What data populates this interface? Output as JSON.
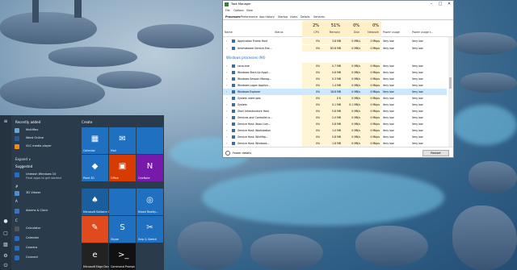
{
  "desktop": {},
  "start": {
    "recently_added": "Recently added",
    "recent": [
      {
        "label": "Multiflex",
        "color": "#6aa3d8",
        "icon": "app-icon"
      },
      {
        "label": "Word Online",
        "color": "#2b579a",
        "icon": "word-icon"
      },
      {
        "label": "VLC media player",
        "color": "#f08a1c",
        "icon": "vlc-icon"
      }
    ],
    "expand": "Expand ∨",
    "suggested": "Suggested",
    "suggest_item": {
      "line1": "Unleash Windows 10",
      "line2": "Final apps to get started"
    },
    "hash": "#",
    "letter_a": "A",
    "letter_c": "C",
    "list_a": [
      {
        "label": "3D Viewer",
        "color": "#4e8cd8"
      },
      {
        "label": "Alarms & Clock",
        "color": "#3a74c4"
      }
    ],
    "list_c": [
      {
        "label": "Calculator",
        "color": "#555"
      },
      {
        "label": "Calendar",
        "color": "#2a6ac0"
      },
      {
        "label": "Camera",
        "color": "#2a6ac0"
      },
      {
        "label": "Connect",
        "color": "#2a6ac0"
      }
    ],
    "create": "Create",
    "tiles": [
      {
        "label": "Calendar",
        "icon": "calendar-icon",
        "glyph": "▦",
        "color": "#1f70c1"
      },
      {
        "label": "Mail",
        "icon": "mail-icon",
        "glyph": "✉",
        "color": "#1f70c1"
      },
      {
        "label": "",
        "icon": "blank-tile",
        "glyph": "",
        "color": "#1f70c1"
      },
      {
        "label": "Paint 3D",
        "icon": "paint3d-icon",
        "glyph": "◆",
        "color": "#1f70c1"
      },
      {
        "label": "Office",
        "icon": "office-icon",
        "glyph": "▣",
        "color": "#d83b01"
      },
      {
        "label": "OneNote",
        "icon": "onenote-icon",
        "glyph": "N",
        "color": "#7719aa"
      },
      {
        "label": "Microsoft Solitaire Collection",
        "icon": "solitaire-icon",
        "glyph": "♠",
        "color": "#1a5e9e"
      },
      {
        "label": "",
        "icon": "blank-tile",
        "glyph": "",
        "color": "#1f70c1"
      },
      {
        "label": "Mixed Reality...",
        "icon": "mixed-reality-icon",
        "glyph": "◎",
        "color": "#1f70c1"
      },
      {
        "label": "",
        "icon": "sketch-icon",
        "glyph": "✎",
        "color": "#e04a1c"
      },
      {
        "label": "Skype",
        "icon": "skype-icon",
        "glyph": "S",
        "color": "#1f70c1"
      },
      {
        "label": "Snip & Sketch",
        "icon": "snip-icon",
        "glyph": "✂",
        "color": "#1f70c1"
      },
      {
        "label": "Microsoft Edge Dev",
        "icon": "edge-dev-icon",
        "glyph": "e",
        "color": "#222"
      },
      {
        "label": "Command Prompt",
        "icon": "cmd-icon",
        "glyph": ">_",
        "color": "#111"
      }
    ]
  },
  "taskmgr": {
    "title": "Task Manager",
    "menu": [
      "File",
      "Options",
      "View"
    ],
    "tabs": [
      "Processes",
      "Performance",
      "App history",
      "Startup",
      "Users",
      "Details",
      "Services"
    ],
    "cols": {
      "name": "Name",
      "status": "Status",
      "cpu_pct": "2%",
      "cpu": "CPU",
      "mem_pct": "51%",
      "mem": "Memory",
      "disk_pct": "0%",
      "disk": "Disk",
      "net_pct": "0%",
      "net": "Network",
      "power": "Power usage",
      "power_trend": "Power usage t..."
    },
    "rows_top": [
      {
        "name": "Application Frame Host",
        "cpu": "0%",
        "mem": "3.8 MB",
        "disk": "0 MB/s",
        "net": "0 Mbps",
        "p": "Very low",
        "pt": "Very low"
      },
      {
        "name": "Antimalware Service Exe...",
        "cpu": "0%",
        "mem": "83.8 MB",
        "disk": "0 MB/s",
        "net": "0 Mbps",
        "p": "Very low",
        "pt": "Very low"
      }
    ],
    "group": "Windows processes (94)",
    "rows": [
      {
        "name": "csrss.exe",
        "cpu": "0%",
        "mem": "0.7 MB",
        "disk": "0 MB/s",
        "net": "0 Mbps",
        "p": "Very low",
        "pt": "Very low"
      },
      {
        "name": "Windows Start-Up Appli...",
        "cpu": "0%",
        "mem": "0.6 MB",
        "disk": "0 MB/s",
        "net": "0 Mbps",
        "p": "Very low",
        "pt": "Very low"
      },
      {
        "name": "Windows Session Manag...",
        "cpu": "0%",
        "mem": "0.3 MB",
        "disk": "0 MB/s",
        "net": "0 Mbps",
        "p": "Very low",
        "pt": "Very low"
      },
      {
        "name": "Windows Logon Applica...",
        "cpu": "0%",
        "mem": "1.4 MB",
        "disk": "0 MB/s",
        "net": "0 Mbps",
        "p": "Very low",
        "pt": "Very low"
      },
      {
        "name": "Windows Explorer",
        "cpu": "0%",
        "mem": "18.8 MB",
        "disk": "0 MB/s",
        "net": "0 Mbps",
        "p": "Very low",
        "pt": "Very low"
      },
      {
        "name": "System interrupts",
        "cpu": "0%",
        "mem": "0 K",
        "disk": "0 MB/s",
        "net": "0 Mbps",
        "p": "Very low",
        "pt": "Very low"
      },
      {
        "name": "System",
        "cpu": "0%",
        "mem": "0.1 MB",
        "disk": "0.1 MB/s",
        "net": "0 Mbps",
        "p": "Very low",
        "pt": "Very low"
      },
      {
        "name": "Shell Infrastructure Host",
        "cpu": "0%",
        "mem": "5.8 MB",
        "disk": "0 MB/s",
        "net": "0 Mbps",
        "p": "Very low",
        "pt": "Very low"
      },
      {
        "name": "Services and Controller a...",
        "cpu": "0%",
        "mem": "2.0 MB",
        "disk": "0 MB/s",
        "net": "0 Mbps",
        "p": "Very low",
        "pt": "Very low"
      },
      {
        "name": "Service Host: Xbox Live...",
        "cpu": "0%",
        "mem": "0.8 MB",
        "disk": "0 MB/s",
        "net": "0 Mbps",
        "p": "Very low",
        "pt": "Very low"
      },
      {
        "name": "Service Host: Workstation",
        "cpu": "0%",
        "mem": "1.0 MB",
        "disk": "0 MB/s",
        "net": "0 Mbps",
        "p": "Very low",
        "pt": "Very low"
      },
      {
        "name": "Service Host: WinHttp...",
        "cpu": "0%",
        "mem": "0.8 MB",
        "disk": "0 MB/s",
        "net": "0 Mbps",
        "p": "Very low",
        "pt": "Very low"
      },
      {
        "name": "Service Host: Windows...",
        "cpu": "0%",
        "mem": "1.6 MB",
        "disk": "0 MB/s",
        "net": "0 Mbps",
        "p": "Very low",
        "pt": "Very low"
      }
    ],
    "fewer": "Fewer details",
    "restart": "Restart"
  }
}
